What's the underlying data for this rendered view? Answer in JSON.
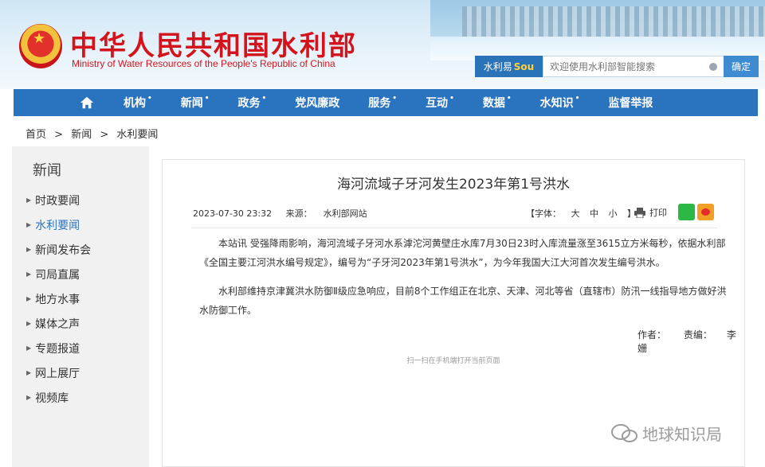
{
  "header": {
    "title_cn": "中华人民共和国水利部",
    "title_en": "Ministry of Water Resources of the People's Republic of China",
    "search": {
      "brand_prefix": "水利易",
      "brand_suffix": "Sou",
      "placeholder": "欢迎使用水利部智能搜索",
      "button": "确定"
    }
  },
  "nav": {
    "items": [
      "机构",
      "新闻",
      "政务",
      "党风廉政",
      "服务",
      "互动",
      "数据",
      "水知识",
      "监督举报"
    ],
    "dot": "•"
  },
  "breadcrumb": [
    "首页",
    ">",
    "新闻",
    ">",
    "水利要闻"
  ],
  "sidebar": {
    "heading": "新闻",
    "items": [
      "时政要闻",
      "水利要闻",
      "新闻发布会",
      "司局直属",
      "地方水事",
      "媒体之声",
      "专题报道",
      "网上展厅",
      "视频库"
    ],
    "active": "水利要闻"
  },
  "article": {
    "title": "海河流域子牙河发生2023年第1号洪水",
    "date": "2023-07-30 23:32",
    "source_label": "来源：",
    "source": "水利部网站",
    "font_label": "【字体：",
    "font_sizes": [
      "大",
      "中",
      "小"
    ],
    "font_close": "】",
    "print": "打印",
    "paragraph1": "本站讯 受强降雨影响，海河流域子牙河水系滹沱河黄壁庄水库7月30日23时入库流量涨至3615立方米每秒，依据水利部《全国主要江河洪水编号规定》，编号为“子牙河2023年第1号洪水”，为今年我国大江大河首次发生编号洪水。",
    "paragraph2": "水利部维持京津冀洪水防御Ⅱ级应急响应，目前8个工作组正在北京、天津、河北等省（直辖市）防汛一线指导地方做好洪水防御工作。",
    "author_label": "作者：",
    "editor_label": "责编：",
    "editor": "李姗",
    "qr_note": "扫一扫在手机端打开当前页面"
  },
  "watermark": "地球知识局",
  "colors": {
    "nav_blue": "#2a74bf",
    "title_red": "#d4141c",
    "active_link": "#2a74bf"
  }
}
